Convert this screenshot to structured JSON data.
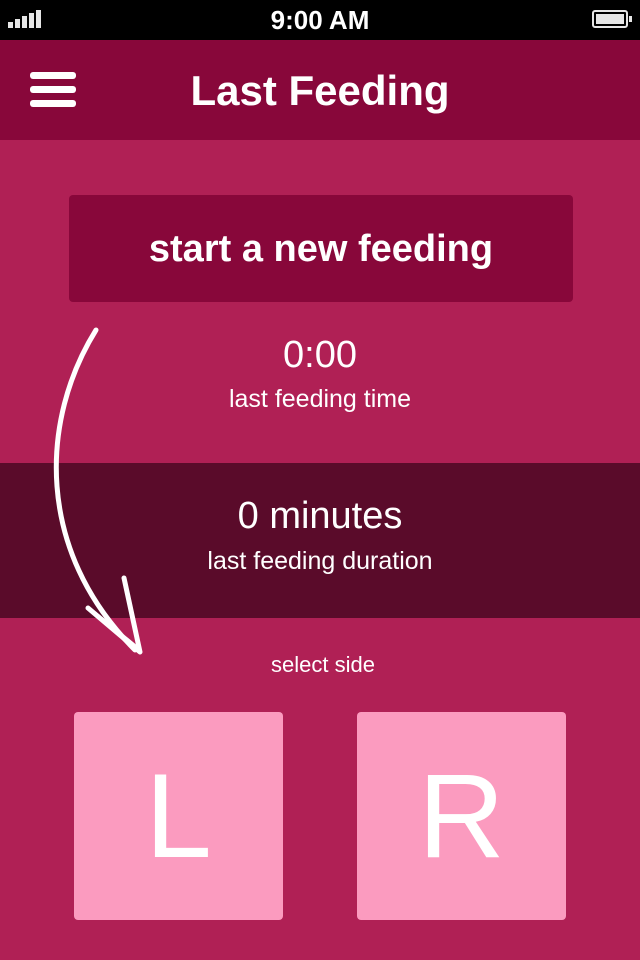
{
  "status_bar": {
    "time": "9:00 AM",
    "signal_icon": "signal-bars-icon",
    "battery_icon": "battery-icon"
  },
  "nav": {
    "title": "Last Feeding",
    "menu_icon": "hamburger-menu-icon"
  },
  "main": {
    "start_button_label": "start a new feeding",
    "last_time_value": "0:00",
    "last_time_label": "last feeding time",
    "last_duration_value": "0 minutes",
    "last_duration_label": "last feeding duration",
    "select_side_label": "select side",
    "left_side_label": "L",
    "right_side_label": "R",
    "hint_arrow_icon": "curved-arrow-icon"
  },
  "colors": {
    "background": "#b02055",
    "nav_bar": "#88073a",
    "start_button": "#88073a",
    "duration_band": "#5a0b2a",
    "side_button": "#fb9bbf",
    "text": "#ffffff"
  }
}
